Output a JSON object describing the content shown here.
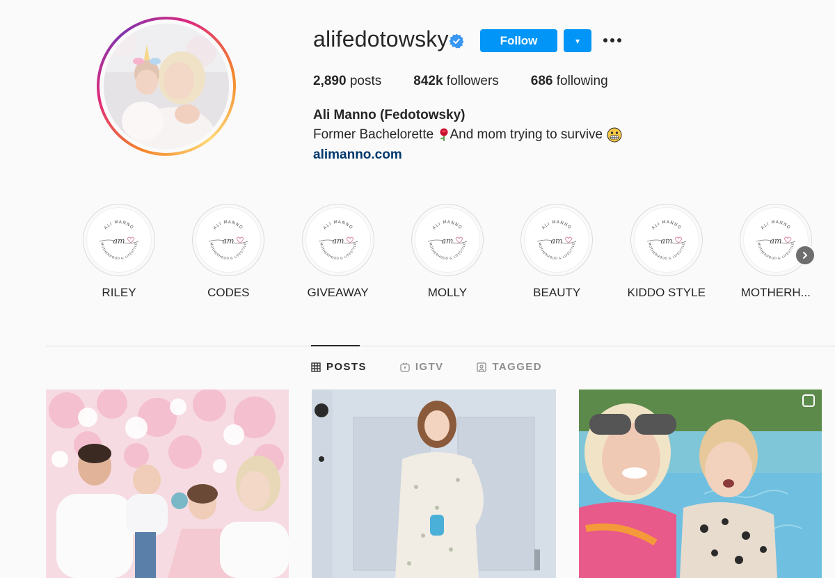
{
  "profile": {
    "username": "alifedotowsky",
    "verified_icon": "verified-badge-icon",
    "follow_label": "Follow",
    "dropdown_label": "▾",
    "more_icon": "more-options-icon",
    "stats": [
      {
        "value": "2,890",
        "label": " posts"
      },
      {
        "value": "842k",
        "label": " followers"
      },
      {
        "value": "686",
        "label": " following"
      }
    ],
    "full_name": "Ali Manno (Fedotowsky)",
    "bio_part1": "Former Bachelorette ",
    "bio_part2": "And mom trying to survive",
    "website": "alimanno.com"
  },
  "highlights": [
    {
      "label": "RILEY"
    },
    {
      "label": "CODES"
    },
    {
      "label": "GIVEAWAY"
    },
    {
      "label": "MOLLY"
    },
    {
      "label": "BEAUTY"
    },
    {
      "label": "KIDDO STYLE"
    },
    {
      "label": "MOTHERH..."
    }
  ],
  "highlight_logo": {
    "top_text": "ALI MANNO",
    "initials": "am",
    "bottom_text": "MOTHERHOOD & LIFESTYLE"
  },
  "tabs": [
    {
      "label": "POSTS",
      "icon": "grid-icon",
      "active": true
    },
    {
      "label": "IGTV",
      "icon": "igtv-icon",
      "active": false
    },
    {
      "label": "TAGGED",
      "icon": "tagged-icon",
      "active": false
    }
  ],
  "colors": {
    "accent": "#0095f6",
    "link": "#00376b",
    "verified": "#3897f0",
    "text": "#262626",
    "muted": "#8e8e8e"
  }
}
